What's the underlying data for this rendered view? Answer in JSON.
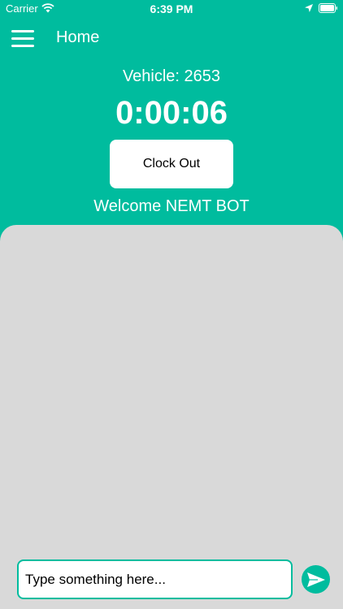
{
  "status_bar": {
    "carrier": "Carrier",
    "time": "6:39 PM",
    "icons": [
      "wifi-icon",
      "location-arrow-icon",
      "battery-icon"
    ]
  },
  "nav": {
    "title": "Home",
    "menu_icon": "hamburger-menu-icon"
  },
  "header": {
    "vehicle": "Vehicle: 2653",
    "timer": "0:00:06",
    "clock_out_label": "Clock Out",
    "welcome": "Welcome NEMT BOT"
  },
  "chat": {
    "input_placeholder": "Type something here...",
    "send_icon": "send-icon"
  },
  "colors": {
    "accent": "#00BC9E",
    "panel": "#D9D9D9",
    "text_on_accent": "#FFFFFF"
  }
}
